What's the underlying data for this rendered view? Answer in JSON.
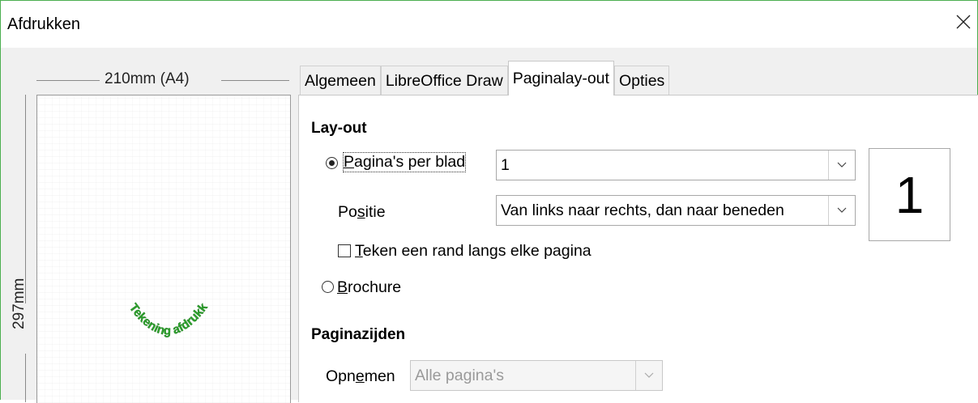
{
  "window": {
    "title": "Afdrukken"
  },
  "preview": {
    "width_label": "210mm (A4)",
    "height_label": "297mm"
  },
  "tabs": [
    {
      "label": "Algemeen",
      "active": false
    },
    {
      "label": "LibreOffice Draw",
      "active": false
    },
    {
      "label": "Paginalay-out",
      "active": true
    },
    {
      "label": "Opties",
      "active": false
    }
  ],
  "layout": {
    "heading": "Lay-out",
    "pages_per_sheet": {
      "label_pre": "",
      "label_mn": "P",
      "label_post": "agina's per blad",
      "selected": true,
      "value": "1"
    },
    "position": {
      "label_pre": "Po",
      "label_mn": "s",
      "label_post": "itie",
      "value": "Van links naar rechts, dan naar beneden"
    },
    "border": {
      "label_mn": "T",
      "label_post": "eken een rand langs elke pagina",
      "checked": false
    },
    "brochure": {
      "label_mn": "B",
      "label_post": "rochure",
      "selected": false
    },
    "page_count_preview": "1"
  },
  "sides": {
    "heading": "Paginazijden",
    "include": {
      "label_pre": "Opn",
      "label_mn": "e",
      "label_post": "men",
      "value": "Alle pagina's",
      "disabled": true
    }
  },
  "watermark_text": "Tekening afdrukken",
  "colors": {
    "window_border": "#4caf50",
    "accent_text": "#2ea22e"
  }
}
